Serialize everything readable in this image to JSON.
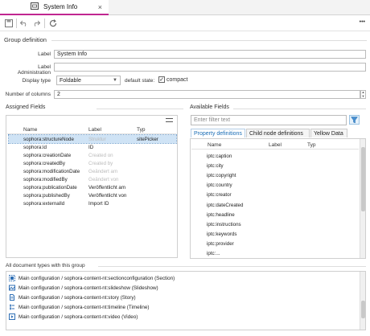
{
  "tab": {
    "title": "System Info"
  },
  "toolbar": {
    "more_label": "•••"
  },
  "group_definition": {
    "title": "Group definition",
    "label_label": "Label",
    "label_value": "System Info",
    "label_admin_label": "Label Administration",
    "label_admin_value": "",
    "display_type_label": "Display type",
    "display_type_value": "Foldable",
    "default_state_label": "default state:",
    "compact_label": "compact",
    "compact_checked": true,
    "columns_label": "Number of columns",
    "columns_value": "2"
  },
  "assigned": {
    "title": "Assigned Fields",
    "col_name": "Name",
    "col_label": "Label",
    "col_typ": "Typ",
    "rows": [
      {
        "name": "sophora:structureNode",
        "label": "Struktur",
        "typ": "sitePicker",
        "muted": true,
        "selected": true
      },
      {
        "name": "sophora:id",
        "label": "ID",
        "typ": "",
        "muted": false
      },
      {
        "name": "sophora:creationDate",
        "label": "Created on",
        "typ": "",
        "muted": true
      },
      {
        "name": "sophora:createdBy",
        "label": "Created by",
        "typ": "",
        "muted": true
      },
      {
        "name": "sophora:modificationDate",
        "label": "Geändert am",
        "typ": "",
        "muted": true
      },
      {
        "name": "sophora:modifiedBy",
        "label": "Geändert von",
        "typ": "",
        "muted": true
      },
      {
        "name": "sophora:publicationDate",
        "label": "Veröffentlicht am",
        "typ": "",
        "muted": false
      },
      {
        "name": "sophora:publishedBy",
        "label": "Veröffentlicht von",
        "typ": "",
        "muted": false
      },
      {
        "name": "sophora:externalId",
        "label": "Import ID",
        "typ": "",
        "muted": false
      }
    ]
  },
  "available": {
    "title": "Available Fields",
    "filter_placeholder": "Enter filter text",
    "tabs": [
      "Property definitions",
      "Child node definitions",
      "Yellow Data"
    ],
    "col_name": "Name",
    "col_label": "Label",
    "col_typ": "Typ",
    "rows": [
      "iptc:caption",
      "iptc:city",
      "iptc:copyright",
      "iptc:country",
      "iptc:creator",
      "iptc:dateCreated",
      "iptc:headline",
      "iptc:instructions",
      "iptc:keywords",
      "iptc:provider",
      "iptc:..."
    ]
  },
  "doc_types": {
    "title": "All document types with this group",
    "rows": [
      {
        "text": "Main configuration / sophora-content-nt:sectionconfiguration (Section)",
        "icon": "section-icon"
      },
      {
        "text": "Main configuration / sophora-content-nt:slideshow (Slideshow)",
        "icon": "slideshow-icon"
      },
      {
        "text": "Main configuration / sophora-content-nt:story (Story)",
        "icon": "document-icon"
      },
      {
        "text": "Main configuration / sophora-content-nt:timeline (Timeline)",
        "icon": "timeline-icon"
      },
      {
        "text": "Main configuration / sophora-content-nt:video (Video)",
        "icon": "video-icon"
      }
    ]
  },
  "colors": {
    "accent": "#c02690",
    "selection": "#cfe3f5",
    "link_blue": "#1a6db5"
  }
}
